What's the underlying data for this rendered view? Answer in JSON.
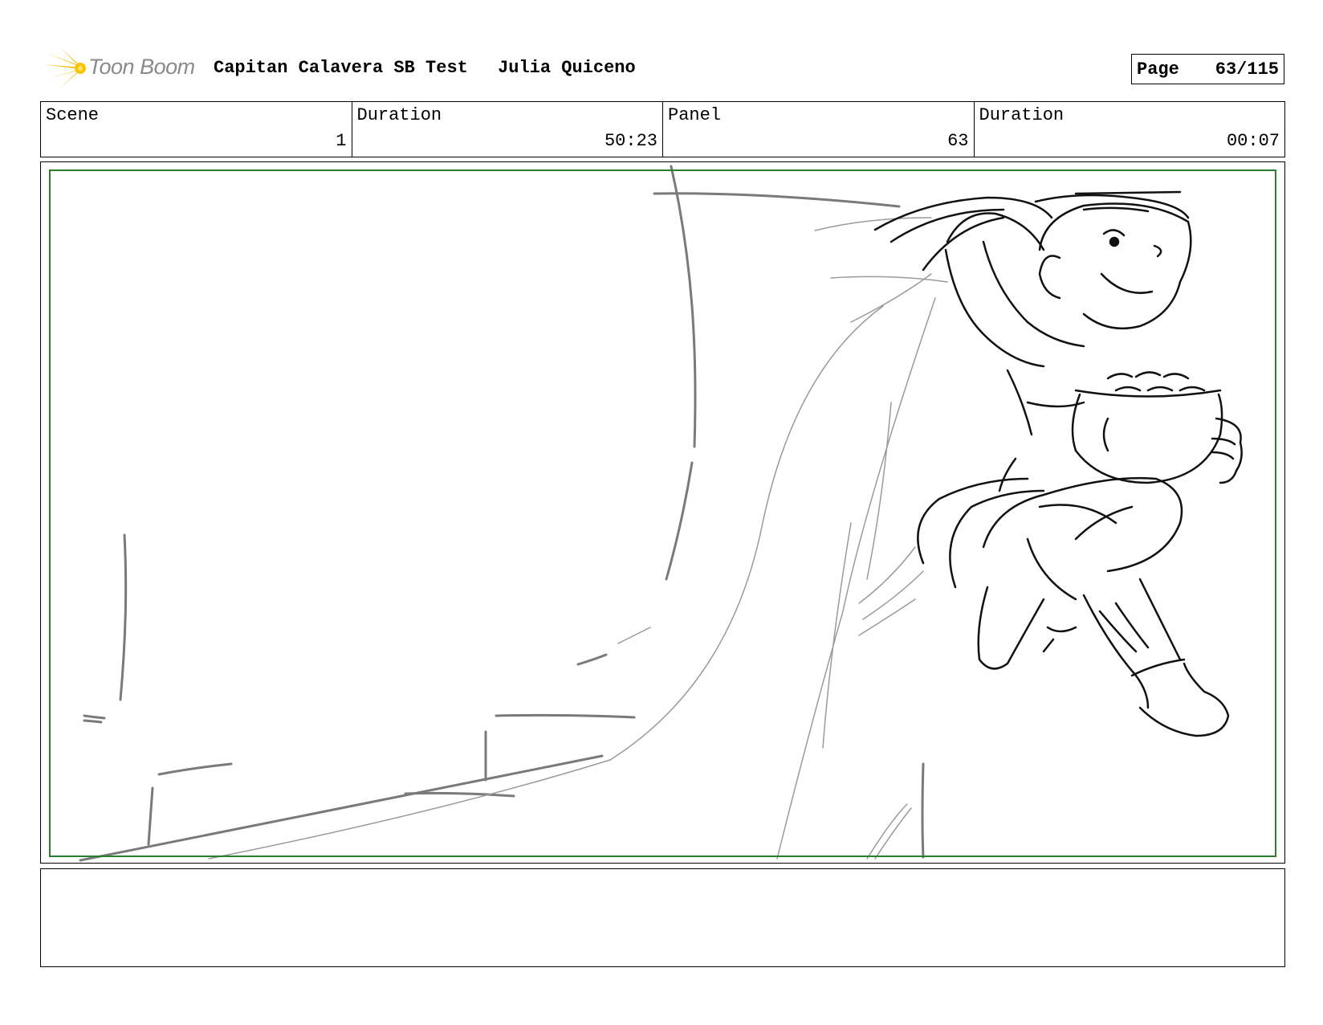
{
  "header": {
    "logo_text": "Toon Boom",
    "project_title": "Capitan Calavera SB Test",
    "author": "Julia Quiceno",
    "page_label": "Page",
    "page_value": "63/115"
  },
  "info": {
    "scene_label": "Scene",
    "scene_value": "1",
    "scene_duration_label": "Duration",
    "scene_duration_value": "50:23",
    "panel_label": "Panel",
    "panel_value": "63",
    "panel_duration_label": "Duration",
    "panel_duration_value": "00:07"
  },
  "panel": {
    "drawing": "storyboard-sketch-character-holding-coin-pot-on-cliff"
  },
  "notes": {
    "text": ""
  },
  "colors": {
    "safe_frame": "#2e7d2e",
    "logo_orange": "#f5b800",
    "logo_text": "#8a8a8a"
  }
}
